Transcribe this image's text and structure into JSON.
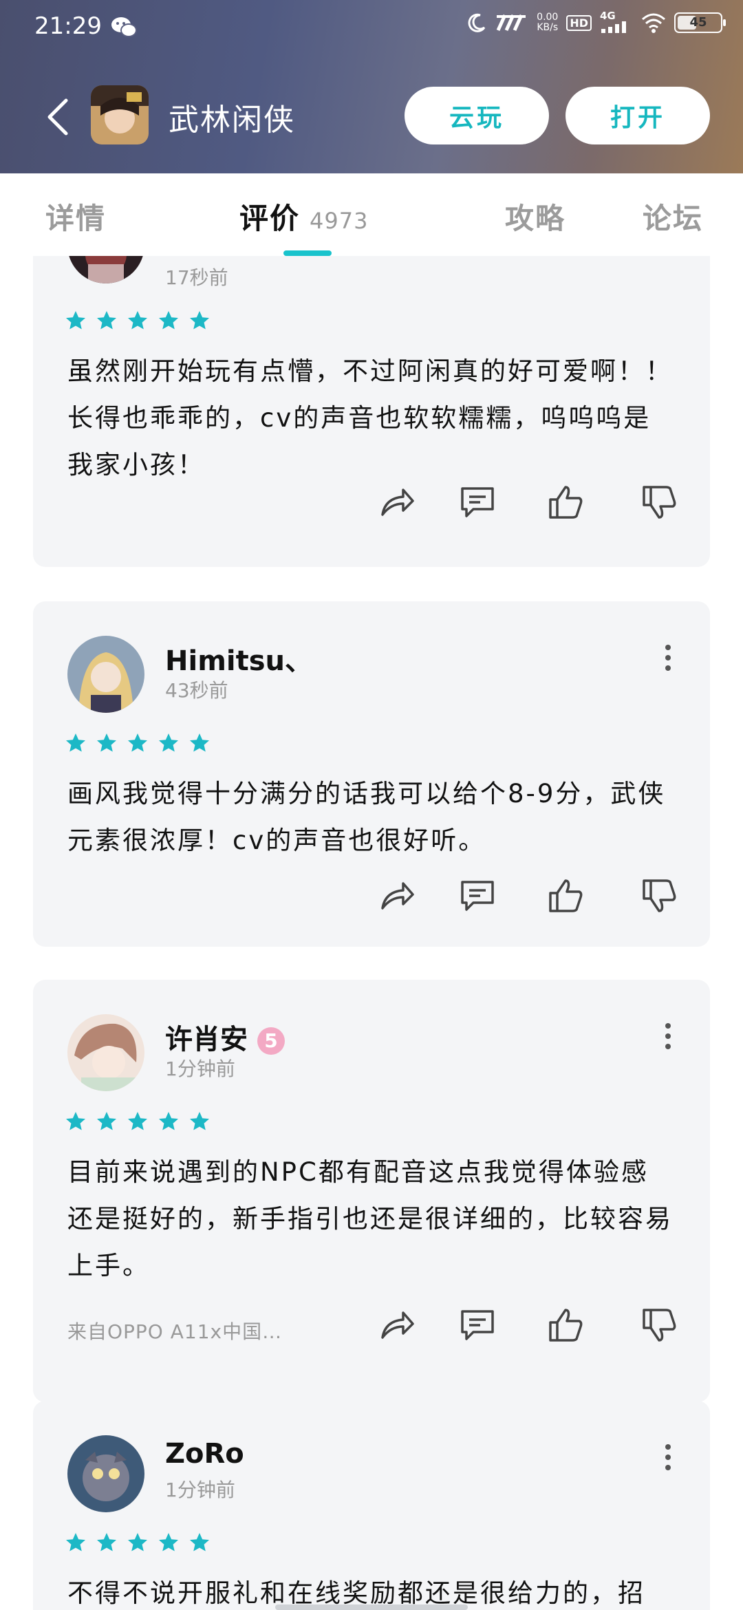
{
  "status_bar": {
    "time": "21:29",
    "net_speed_value": "0.00",
    "net_speed_unit": "KB/s",
    "hd_label": "HD",
    "network": "4G",
    "battery": "45"
  },
  "header": {
    "app_name": "武林闲侠",
    "cloud_play_label": "云玩",
    "open_label": "打开"
  },
  "tabs": [
    {
      "label": "详情"
    },
    {
      "label": "评价",
      "count": "4973"
    },
    {
      "label": "攻略"
    },
    {
      "label": "论坛"
    }
  ],
  "reviews": [
    {
      "time": "17秒前",
      "stars": 5,
      "text": "虽然刚开始玩有点懵，不过阿闲真的好可爱啊！！长得也乖乖的，cv的声音也软软糯糯，呜呜呜是我家小孩！"
    },
    {
      "username": "Himitsu、",
      "time": "43秒前",
      "stars": 5,
      "text": "画风我觉得十分满分的话我可以给个8-9分，武侠元素很浓厚！cv的声音也很好听。"
    },
    {
      "username": "许肖安",
      "badge": "5",
      "time": "1分钟前",
      "stars": 5,
      "text": "目前来说遇到的NPC都有配音这点我觉得体验感还是挺好的，新手指引也还是很详细的，比较容易上手。",
      "device": "来自OPPO A11x中国…"
    },
    {
      "username": "ZoRo",
      "time": "1分钟前",
      "stars": 5,
      "text": "不得不说开服礼和在线奖励都还是很给力的，招"
    }
  ],
  "colors": {
    "accent": "#19c3cc",
    "star": "#1cb8c6",
    "card_bg": "#f4f5f7"
  }
}
